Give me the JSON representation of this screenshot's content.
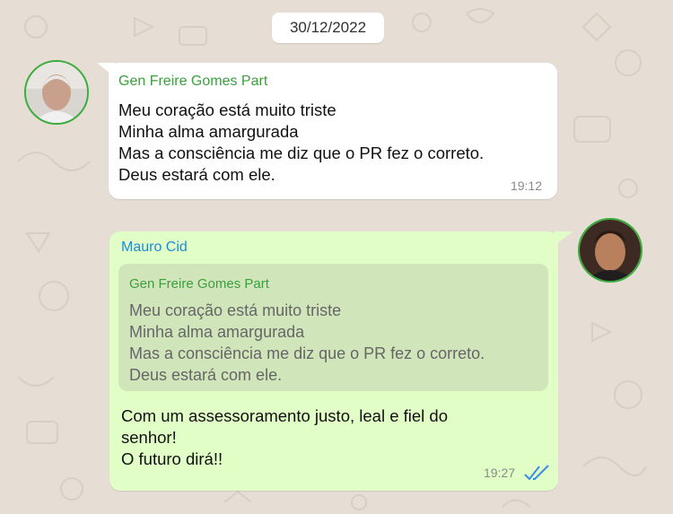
{
  "date_separator": "30/12/2022",
  "messages": [
    {
      "sender": "Gen Freire Gomes Part",
      "text": "Meu coração está muito triste\nMinha alma amargurada\nMas a consciência me diz que o PR fez o correto.\nDeus estará com ele.",
      "time": "19:12",
      "direction": "incoming",
      "avatar_icon": "contact-avatar-icon"
    },
    {
      "sender": "Mauro Cid",
      "quoted": {
        "sender": "Gen Freire Gomes Part",
        "text": "Meu coração está muito triste\nMinha alma amargurada\nMas a consciência me diz que o PR fez o correto.\nDeus estará com ele."
      },
      "text": "Com um assessoramento justo, leal e fiel do\nsenhor!\nO futuro dirá!!",
      "time": "19:27",
      "status": "read",
      "direction": "outgoing",
      "avatar_icon": "contact-avatar-icon"
    }
  ],
  "colors": {
    "background": "#e6ddd4",
    "incoming_bubble": "#ffffff",
    "outgoing_bubble": "#e1fec6",
    "quote_background": "#d1e5bb",
    "sender_green": "#3a9f3c",
    "sender_blue": "#1f8bd8",
    "read_ticks": "#3b8ce4"
  }
}
